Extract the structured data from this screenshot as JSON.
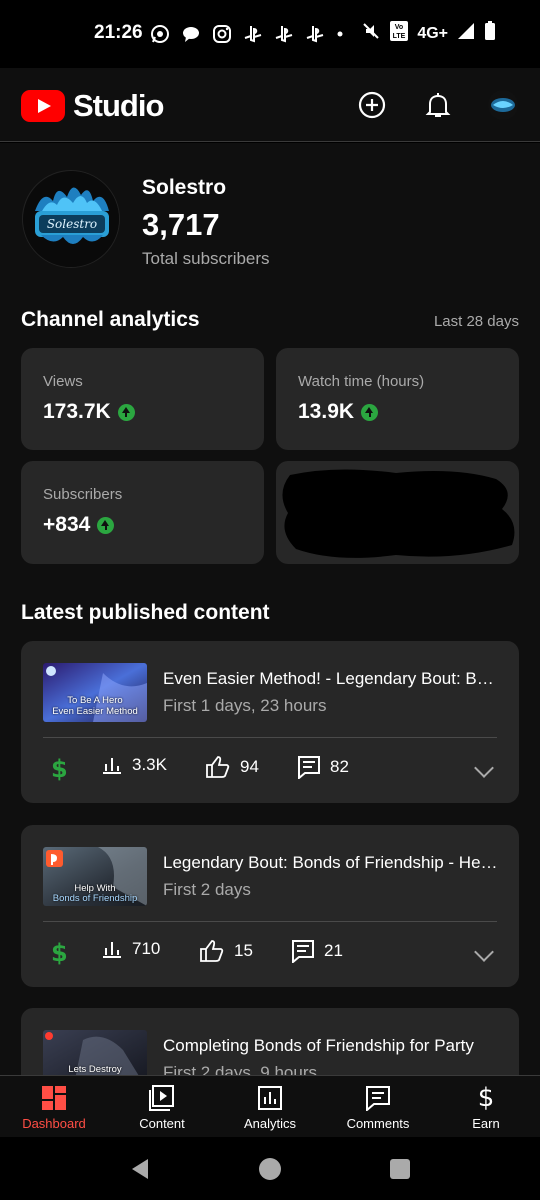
{
  "status_bar": {
    "time": "21:26",
    "network": "4G+"
  },
  "app": {
    "name": "Studio"
  },
  "channel": {
    "name": "Solestro",
    "subscriber_count": "3,717",
    "subscriber_label": "Total subscribers",
    "avatar_text": "Solestro"
  },
  "analytics": {
    "title": "Channel analytics",
    "period": "Last 28 days",
    "cards": [
      {
        "label": "Views",
        "value": "173.7K",
        "trend": "up"
      },
      {
        "label": "Watch time (hours)",
        "value": "13.9K",
        "trend": "up"
      },
      {
        "label": "Subscribers",
        "value": "+834",
        "trend": "up"
      }
    ]
  },
  "latest": {
    "title": "Latest published content",
    "videos": [
      {
        "title": "Even Easier Method! - Legendary Bout: Bonds of Friendship",
        "age": "First 1 days, 23 hours",
        "views": "3.3K",
        "likes": "94",
        "comments": "82",
        "thumb_text_1": "To Be A Hero",
        "thumb_text_2": "Even Easier Method"
      },
      {
        "title": "Legendary Bout: Bonds of Friendship - Help With",
        "age": "First 2 days",
        "views": "710",
        "likes": "15",
        "comments": "21",
        "thumb_text_1": "Help With",
        "thumb_text_2": "Bonds of Friendship"
      },
      {
        "title": "Completing Bonds of Friendship for Party",
        "age": "First 2 days, 9 hours",
        "thumb_text_1": "Lets Destroy"
      }
    ]
  },
  "bottom_nav": {
    "items": [
      {
        "label": "Dashboard",
        "active": true
      },
      {
        "label": "Content"
      },
      {
        "label": "Analytics"
      },
      {
        "label": "Comments"
      },
      {
        "label": "Earn"
      }
    ]
  },
  "colors": {
    "accent": "#ff0000",
    "active_nav": "#ff4e45",
    "positive": "#2ba640",
    "card_bg": "#272727",
    "page_bg": "#0f0f0f"
  }
}
